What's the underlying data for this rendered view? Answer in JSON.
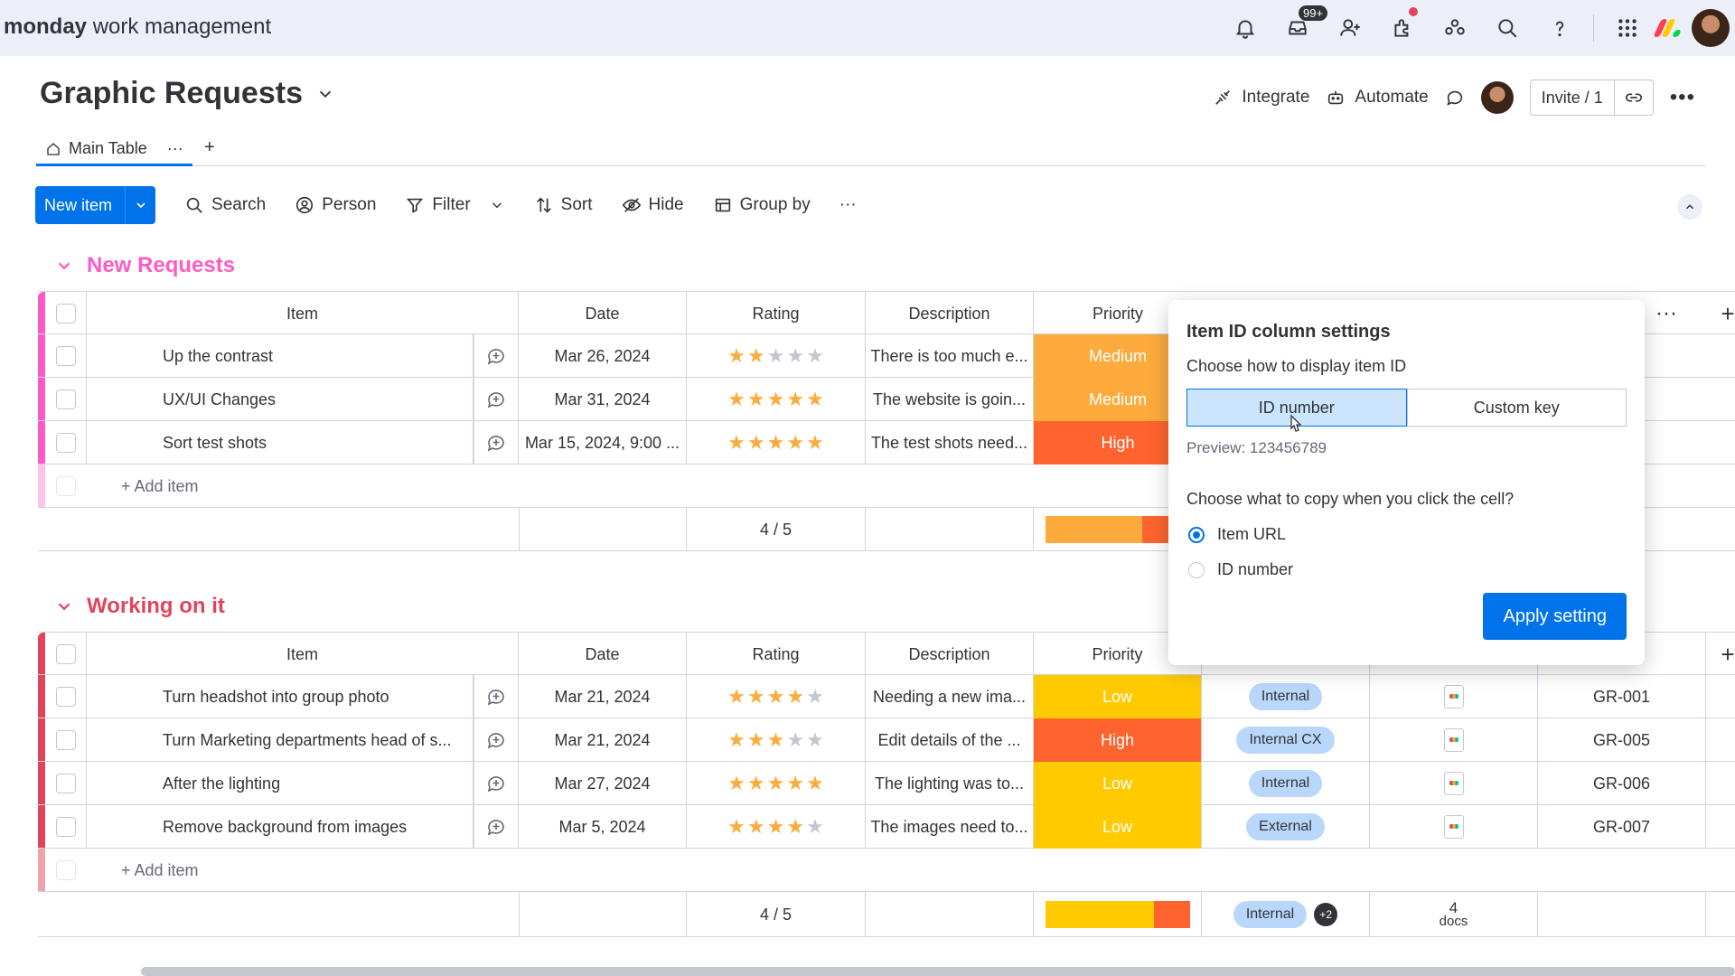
{
  "topbar": {
    "brand_bold": "monday",
    "brand_rest": "work management",
    "inbox_badge": "99+"
  },
  "board": {
    "title": "Graphic Requests",
    "actions": {
      "integrate": "Integrate",
      "automate": "Automate",
      "invite": "Invite / 1"
    },
    "tabs": [
      {
        "label": "Main Table"
      }
    ],
    "tab_plus": "+",
    "tab_more": "···"
  },
  "toolbar": {
    "new_item": "New item",
    "search": "Search",
    "person": "Person",
    "filter": "Filter",
    "sort": "Sort",
    "hide": "Hide",
    "group_by": "Group by",
    "more": "···"
  },
  "columns": {
    "item": "Item",
    "date": "Date",
    "rating": "Rating",
    "description": "Description",
    "priority": "Priority"
  },
  "groups": [
    {
      "name": "New Requests",
      "color": "#ff5ac4",
      "items": [
        {
          "name": "Up the contrast",
          "date": "Mar 26, 2024",
          "rating": 2,
          "description": "There is too much e...",
          "priority": "Medium",
          "priority_color": "#fdab3d"
        },
        {
          "name": "UX/UI Changes",
          "date": "Mar 31, 2024",
          "rating": 5,
          "description": "The website is goin...",
          "priority": "Medium",
          "priority_color": "#fdab3d"
        },
        {
          "name": "Sort test shots",
          "date": "Mar 15, 2024, 9:00 ...",
          "rating": 5,
          "description": "The test shots need...",
          "priority": "High",
          "priority_color": "#ff642e"
        }
      ],
      "add_item": "+ Add item",
      "summary_rating": "4 / 5"
    },
    {
      "name": "Working on it",
      "color": "#e2445c",
      "items": [
        {
          "name": "Turn headshot into group photo",
          "date": "Mar 21, 2024",
          "rating": 4,
          "description": "Needing a new ima...",
          "priority": "Low",
          "priority_color": "#ffcb00",
          "type": "Internal",
          "item_id": "GR-001"
        },
        {
          "name": "Turn Marketing departments head of s...",
          "date": "Mar 21, 2024",
          "rating": 3,
          "description": "Edit details of the ...",
          "priority": "High",
          "priority_color": "#ff642e",
          "type": "Internal CX",
          "item_id": "GR-005"
        },
        {
          "name": "After the lighting",
          "date": "Mar 27, 2024",
          "rating": 5,
          "description": "The lighting was to...",
          "priority": "Low",
          "priority_color": "#ffcb00",
          "type": "Internal",
          "item_id": "GR-006"
        },
        {
          "name": "Remove background from images",
          "date": "Mar 5, 2024",
          "rating": 4,
          "description": "The images need to...",
          "priority": "Low",
          "priority_color": "#ffcb00",
          "type": "External",
          "item_id": "GR-007"
        }
      ],
      "add_item": "+ Add item",
      "summary_rating": "4 / 5",
      "summary_type": "Internal",
      "summary_type_more": "+2",
      "summary_docs_count": "4",
      "summary_docs_label": "docs"
    }
  ],
  "settings_panel": {
    "title": "Item ID column settings",
    "display_label": "Choose how to display item ID",
    "option_id_number": "ID number",
    "option_custom_key": "Custom key",
    "preview": "Preview: 123456789",
    "copy_label": "Choose what to copy when you click the cell?",
    "radio_item_url": "Item URL",
    "radio_id_number": "ID number",
    "apply": "Apply setting"
  }
}
